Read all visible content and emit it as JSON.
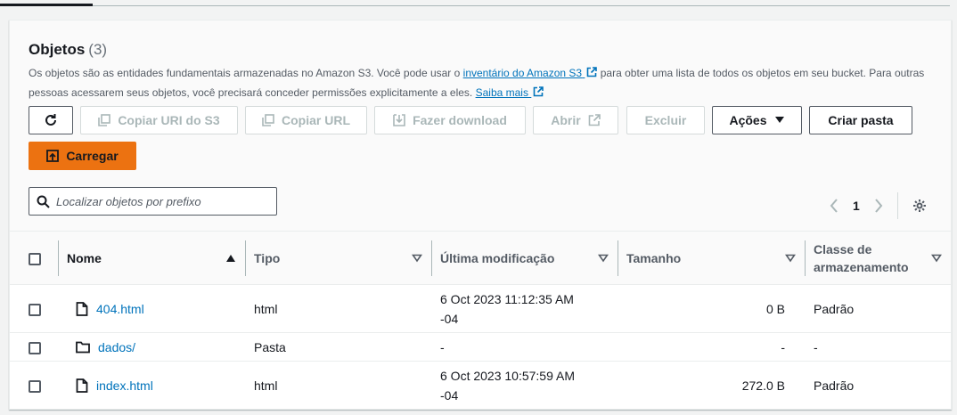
{
  "header": {
    "title": "Objetos",
    "count": "(3)",
    "desc_part1": "Os objetos são as entidades fundamentais armazenadas no Amazon S3. Você pode usar o ",
    "inventory_link": "inventário do Amazon S3",
    "desc_part2": " para obter uma lista de todos os objetos em seu bucket. Para outras pessoas acessarem seus objetos, você precisará conceder permissões explicitamente a eles. ",
    "learn_more": "Saiba mais"
  },
  "toolbar": {
    "copy_uri": "Copiar URI do S3",
    "copy_url": "Copiar URL",
    "download": "Fazer download",
    "open": "Abrir",
    "delete": "Excluir",
    "actions": "Ações",
    "create_folder": "Criar pasta",
    "upload": "Carregar"
  },
  "search": {
    "placeholder": "Localizar objetos por prefixo"
  },
  "pagination": {
    "page": "1"
  },
  "table": {
    "columns": [
      "Nome",
      "Tipo",
      "Última modificação",
      "Tamanho",
      "Classe de armazenamento"
    ],
    "rows": [
      {
        "name": "404.html",
        "icon": "file-icon",
        "type": "html",
        "modified_line1": "6 Oct 2023 11:12:35 AM",
        "modified_line2": "-04",
        "size": "0 B",
        "storage": "Padrão"
      },
      {
        "name": "dados/",
        "icon": "folder-icon",
        "type": "Pasta",
        "modified_line1": "-",
        "modified_line2": "",
        "size": "-",
        "storage": "-"
      },
      {
        "name": "index.html",
        "icon": "file-icon",
        "type": "html",
        "modified_line1": "6 Oct 2023 10:57:59 AM",
        "modified_line2": "-04",
        "size": "272.0 B",
        "storage": "Padrão"
      }
    ]
  },
  "colors": {
    "link": "#0073bb",
    "primary": "#ec7211",
    "disabled": "#aab7b8"
  }
}
